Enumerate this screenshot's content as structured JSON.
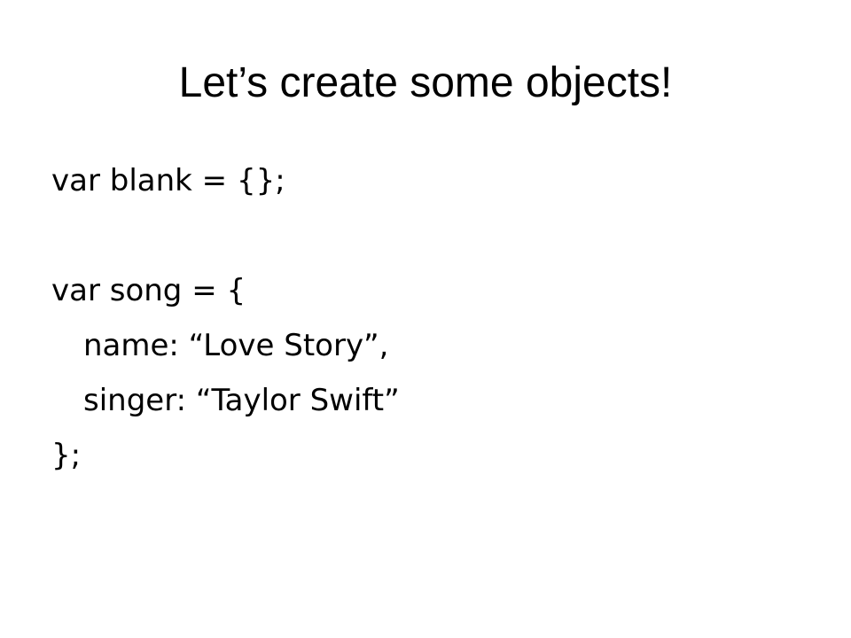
{
  "slide": {
    "title": "Let’s create some objects!",
    "lines": [
      "var blank = {};",
      "",
      "var song = {",
      "name: “Love Story”,",
      "singer: “Taylor Swift”",
      "};"
    ]
  }
}
